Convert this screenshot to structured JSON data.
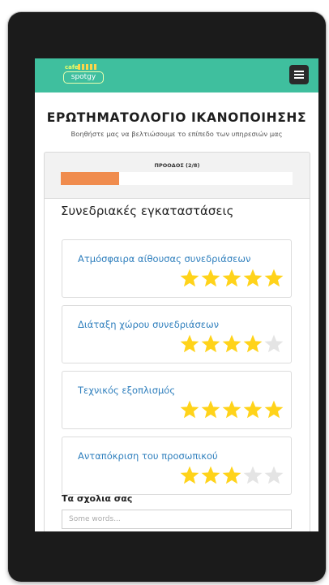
{
  "header": {
    "logo_small": "cafe",
    "logo_text": "spotgy",
    "menu_icon": "hamburger-menu-icon"
  },
  "survey": {
    "title": "ΕΡΩΤΗΜΑΤΟΛΟΓΙΟ ΙΚΑΝΟΠΟΙΗΣΗΣ",
    "subtitle": "Βοηθήστε μας να βελτιώσουμε το επίπεδο των υπηρεσιών μας"
  },
  "progress": {
    "label": "ΠΡΟΟΔΟΣ (2/8)",
    "fraction": 0.25,
    "color": "#f08c4e"
  },
  "section": {
    "title": "Συνεδριακές εγκαταστάσεις",
    "questions": [
      {
        "label": "Ατμόσφαιρα αίθουσας συνεδριάσεων",
        "rating": 5,
        "max": 5
      },
      {
        "label": "Διάταξη χώρου συνεδριάσεων",
        "rating": 4,
        "max": 5
      },
      {
        "label": "Τεχνικός εξοπλισμός",
        "rating": 5,
        "max": 5
      },
      {
        "label": "Ανταπόκριση του προσωπικού",
        "rating": 3,
        "max": 5
      }
    ]
  },
  "comments": {
    "label": "Τα σχολια σας",
    "placeholder": "Some words..."
  },
  "colors": {
    "topbar": "#3fbf9e",
    "star_filled": "#ffd31a",
    "star_empty": "#e4e4e4",
    "link": "#2f7fbd"
  }
}
